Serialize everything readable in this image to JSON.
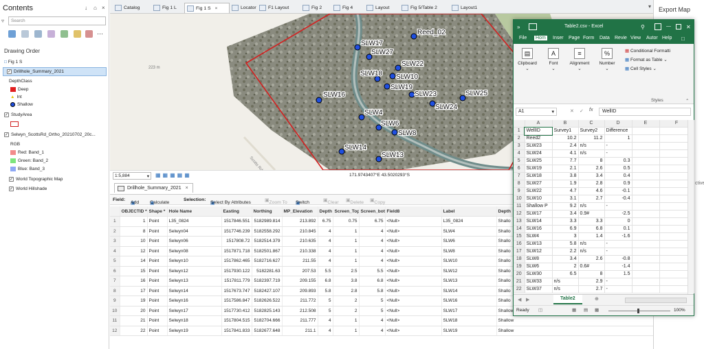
{
  "contents": {
    "title": "Contents",
    "controls": [
      "↓",
      "⌂",
      "×"
    ],
    "search_placeholder": "Search",
    "drawing_order_label": "Drawing Order",
    "map_name": "Fig 1 S",
    "layers": [
      {
        "name": "Drillhole_Summary_2021",
        "checked": true,
        "selected": true
      },
      {
        "name": "DepthClass",
        "checked": null
      },
      {
        "name": "Deep",
        "swatch": "#e11f1f"
      },
      {
        "name": "Int",
        "swatch": "#ffe600"
      },
      {
        "name": "Shallow",
        "swatch": "#1f4fe0"
      },
      {
        "name": "StudyArea",
        "checked": true
      },
      {
        "name": "Selwyn_ScottsRd_Ortho_20210702_20c...",
        "checked": true
      },
      {
        "name": "RGB",
        "checked": null
      },
      {
        "name": "Red:  Band_1",
        "swatch": "#f28b8b"
      },
      {
        "name": "Green: Band_2",
        "swatch": "#7ee57e"
      },
      {
        "name": "Blue:  Band_3",
        "swatch": "#8fa8f5"
      },
      {
        "name": "World Topographic Map",
        "checked": true
      },
      {
        "name": "World Hillshade",
        "checked": true
      }
    ]
  },
  "tabs": [
    {
      "label": "Catalog",
      "active": false
    },
    {
      "label": "Fig 1 L",
      "active": false
    },
    {
      "label": "Fig 1 S",
      "active": true
    },
    {
      "label": "Locator",
      "active": false
    },
    {
      "label": "F1 Layout",
      "active": false
    },
    {
      "label": "Fig 2",
      "active": false
    },
    {
      "label": "Fig 4",
      "active": false
    },
    {
      "label": "Layout",
      "active": false
    },
    {
      "label": "Fig 5/Table 2",
      "active": false
    },
    {
      "label": "Layout1",
      "active": false
    }
  ],
  "map": {
    "elevation_label": "223 m",
    "road_label": "Scotts Rd",
    "scale": "1:5,884",
    "coordinates": "171.9743407°E 43.5020293°S",
    "points": [
      "Reed_02",
      "SLW17",
      "SLW27",
      "SLW22",
      "SLW18",
      "SLW10",
      "SLW19",
      "SLW23",
      "SLW25",
      "SLW16",
      "SLW24",
      "SLW4",
      "SLW6",
      "SLW8",
      "SLW14",
      "SLW13"
    ]
  },
  "attribute_table": {
    "tab_label": "Drillhole_Summary_2021",
    "toolbar": {
      "field_label": "Field:",
      "add": "Add",
      "calculate": "Calculate",
      "selection_label": "Selection:",
      "select_by_attributes": "Select By Attributes",
      "zoom_to": "Zoom To",
      "switch": "Switch",
      "clear": "Clear",
      "delete": "Delete",
      "copy": "Copy"
    },
    "columns": [
      "OBJECTID *",
      "Shape *",
      "Hole Name",
      "Easting",
      "Northing",
      "MP_Elevation",
      "Depth",
      "Screen_Top",
      "Screen_bot",
      "Field8",
      "Label",
      "Depth"
    ],
    "rows": [
      [
        "1",
        "1",
        "Point",
        "L35_0824",
        "1517846.551",
        "5182989.814",
        "213.892",
        "6.75",
        "0.75",
        "6.75",
        "<Null>",
        "L35_0824",
        "Shallo"
      ],
      [
        "2",
        "8",
        "Point",
        "Selwyn04",
        "1517746.239",
        "5182558.292",
        "210.845",
        "4",
        "1",
        "4",
        "<Null>",
        "SLW4",
        "Shallo"
      ],
      [
        "3",
        "10",
        "Point",
        "Selwyn06",
        "1517808.72",
        "5182514.379",
        "210.635",
        "4",
        "1",
        "4",
        "<Null>",
        "SLW6",
        "Shallo"
      ],
      [
        "4",
        "12",
        "Point",
        "Selwyn08",
        "1517871.718",
        "5182501.867",
        "210.338",
        "4",
        "1",
        "4",
        "<Null>",
        "SLW8",
        "Shallo"
      ],
      [
        "5",
        "14",
        "Point",
        "Selwyn10",
        "1517862.465",
        "5182716.627",
        "211.55",
        "4",
        "1",
        "4",
        "<Null>",
        "SLW10",
        "Shallo"
      ],
      [
        "6",
        "15",
        "Point",
        "Selwyn12",
        "1517930.122",
        "5182281.63",
        "207.53",
        "5.5",
        "2.5",
        "5.5",
        "<Null>",
        "SLW12",
        "Shallo"
      ],
      [
        "7",
        "16",
        "Point",
        "Selwyn13",
        "1517811.779",
        "5182397.719",
        "209.155",
        "6.8",
        "3.8",
        "6.8",
        "<Null>",
        "SLW13",
        "Shallo"
      ],
      [
        "8",
        "17",
        "Point",
        "Selwyn14",
        "1517673.747",
        "5182427.107",
        "209.893",
        "5.8",
        "2.8",
        "5.8",
        "<Null>",
        "SLW14",
        "Shallo"
      ],
      [
        "9",
        "19",
        "Point",
        "Selwyn16",
        "1517586.847",
        "5182626.522",
        "211.772",
        "5",
        "2",
        "5",
        "<Null>",
        "SLW16",
        "Shallo"
      ],
      [
        "10",
        "20",
        "Point",
        "Selwyn17",
        "1517730.412",
        "5182825.143",
        "212.508",
        "5",
        "2",
        "5",
        "<Null>",
        "SLW17",
        "Shallow"
      ],
      [
        "11",
        "21",
        "Point",
        "Selwyn18",
        "1517804.515",
        "5182704.666",
        "211.777",
        "4",
        "1",
        "4",
        "<Null>",
        "SLW18",
        "Shallow"
      ],
      [
        "12",
        "22",
        "Point",
        "Selwyn19",
        "1517841.833",
        "5182677.648",
        "211.1",
        "4",
        "1",
        "4",
        "<Null>",
        "SLW19",
        "Shallow"
      ]
    ]
  },
  "export": {
    "title": "Export Map",
    "partial_text": "ctive"
  },
  "excel": {
    "title": "Table2.csv - Excel",
    "menu": [
      "File",
      "Hom",
      "Inser",
      "Page",
      "Form",
      "Data",
      "Revie",
      "View",
      "Autor",
      "Help"
    ],
    "ribbon": {
      "clipboard": "Clipboard",
      "font": "Font",
      "alignment": "Alignment",
      "number": "Number",
      "conditional": "Conditional Formatti",
      "format_table": "Format as Table",
      "cell_styles": "Cell Styles",
      "styles": "Styles"
    },
    "name_box": "A1",
    "formula": "WellID",
    "col_headers": [
      "A",
      "B",
      "C",
      "D",
      "E",
      "F"
    ],
    "rows": [
      [
        "WellID",
        "Survey1",
        "Survey2",
        "Difference",
        "",
        ""
      ],
      [
        "Reed2",
        "10.2",
        "11.2",
        "1",
        "",
        ""
      ],
      [
        "SLW23",
        "2.4",
        "n/s",
        "-",
        "",
        ""
      ],
      [
        "SLW24",
        "4.1",
        "n/s",
        "-",
        "",
        ""
      ],
      [
        "SLW25",
        "7.7",
        "8",
        "0.3",
        "",
        ""
      ],
      [
        "SLW19",
        "2.1",
        "2.6",
        "0.5",
        "",
        ""
      ],
      [
        "SLW18",
        "3.8",
        "3.4",
        "0.4",
        "",
        ""
      ],
      [
        "SLW27",
        "1.9",
        "2.8",
        "0.9",
        "",
        ""
      ],
      [
        "SLW22",
        "4.7",
        "4.6",
        "-0.1",
        "",
        ""
      ],
      [
        "SLW10",
        "3.1",
        "2.7",
        "-0.4",
        "",
        ""
      ],
      [
        "Shallow P",
        "9.2",
        "n/s",
        "-",
        "",
        ""
      ],
      [
        "SLW17",
        "3.4",
        "0.9#",
        "-2.5",
        "",
        ""
      ],
      [
        "SLW14",
        "3.3",
        "3.3",
        "0",
        "",
        ""
      ],
      [
        "SLW16",
        "6.9",
        "6.8",
        "0.1",
        "",
        ""
      ],
      [
        "SLW4",
        "3",
        "1.4",
        "-1.6",
        "",
        ""
      ],
      [
        "SLW13",
        "5.8",
        "n/s",
        "-",
        "",
        ""
      ],
      [
        "SLW12",
        "2.2",
        "n/s",
        "-",
        "",
        ""
      ],
      [
        "SLW8",
        "3.4",
        "2.6",
        "-0.8",
        "",
        ""
      ],
      [
        "SLW6",
        "2",
        "0.6#",
        "-1.4",
        "",
        ""
      ],
      [
        "SLW30",
        "6.5",
        "8",
        "1.5",
        "",
        ""
      ],
      [
        "SLW33",
        "n/s",
        "2.9",
        "-",
        "",
        ""
      ],
      [
        "SLW37",
        "n/s",
        "2.7",
        "-",
        "",
        ""
      ]
    ],
    "sheet_tab": "Table2",
    "status": "Ready",
    "zoom": "100%"
  }
}
